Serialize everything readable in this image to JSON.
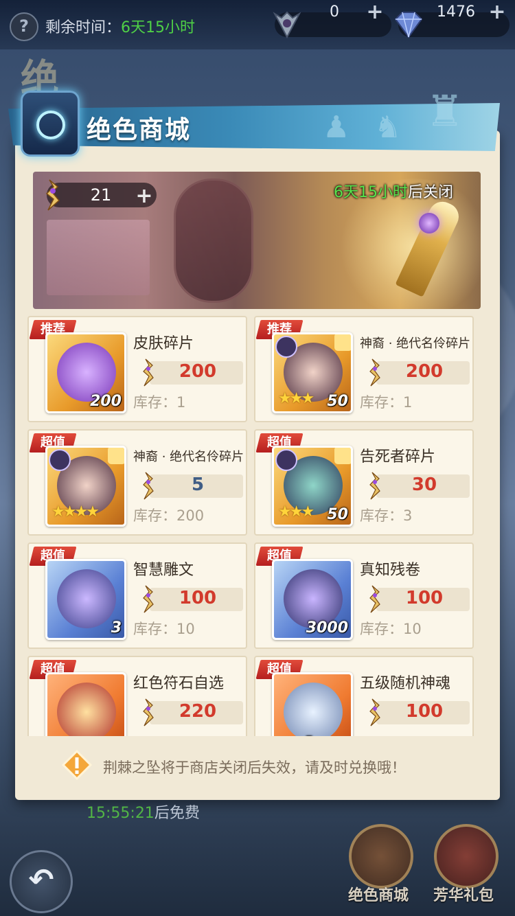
{
  "topbar": {
    "help_icon": "question-icon",
    "time_left_label": "剩余时间：",
    "time_left_value": "6天15小时",
    "currency1_value": "0",
    "currency2_value": "1476",
    "plus": "+"
  },
  "background_title_char": "绝",
  "header": {
    "title": "绝色商城"
  },
  "banner": {
    "token_count": "21",
    "plus": "+",
    "close_time_green": "6天15小时",
    "close_time_suffix": "后关闭"
  },
  "items": [
    {
      "tag": "推荐",
      "name": "皮肤碎片",
      "price": "200",
      "stock": "库存：1",
      "qty": "200",
      "quality": "gold",
      "price_color": "red"
    },
    {
      "tag": "推荐",
      "name": "神裔 · 绝代名伶碎片",
      "price": "200",
      "stock": "库存：1",
      "qty": "50",
      "stars": "★★★",
      "quality": "gold",
      "price_color": "red"
    },
    {
      "tag": "超值",
      "name": "神裔 · 绝代名伶碎片",
      "price": "5",
      "stock": "库存：200",
      "qty": "",
      "stars": "★★★★",
      "quality": "gold",
      "price_color": "blue"
    },
    {
      "tag": "超值",
      "name": "告死者碎片",
      "price": "30",
      "stock": "库存：3",
      "qty": "50",
      "stars": "★★★",
      "quality": "gold",
      "price_color": "red"
    },
    {
      "tag": "超值",
      "name": "智慧雕文",
      "price": "100",
      "stock": "库存：10",
      "qty": "3",
      "quality": "blue",
      "price_color": "red"
    },
    {
      "tag": "超值",
      "name": "真知残卷",
      "price": "100",
      "stock": "库存：10",
      "qty": "3000",
      "quality": "blue",
      "price_color": "red"
    },
    {
      "tag": "超值",
      "name": "红色符石自选",
      "price": "220",
      "stock": "",
      "qty": "",
      "quality": "orange",
      "price_color": "red"
    },
    {
      "tag": "超值",
      "name": "五级随机神魂",
      "price": "100",
      "stock": "",
      "qty": "",
      "rank_num": "5",
      "quality": "orange",
      "price_color": "red"
    }
  ],
  "notice": {
    "text": "荆棘之坠将于商店关闭后失效，请及时兑换哦！"
  },
  "bottom": {
    "free_timer_value": "15:55:21",
    "free_timer_suffix": "后免费",
    "nav_shop_label": "绝色商城",
    "nav_gift_label": "芳华礼包",
    "back_icon": "back-arrow-icon"
  },
  "colors": {
    "green": "#4fd046",
    "price_red": "#d23a2c",
    "price_blue": "#3f5d86",
    "tag_red": "#c82a24",
    "panel": "#f1e9d6"
  }
}
